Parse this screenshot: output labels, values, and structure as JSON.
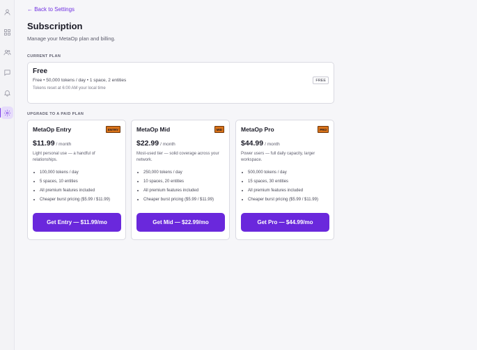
{
  "sidebar": {
    "items": [
      {
        "name": "profile",
        "icon": "user-icon"
      },
      {
        "name": "dashboard",
        "icon": "grid-icon"
      },
      {
        "name": "people",
        "icon": "users-icon"
      },
      {
        "name": "messages",
        "icon": "chat-icon"
      },
      {
        "name": "notifications",
        "icon": "bell-icon"
      },
      {
        "name": "settings",
        "icon": "gear-icon",
        "active": true
      }
    ]
  },
  "header": {
    "back_label": "← Back to Settings",
    "title": "Subscription",
    "subtitle": "Manage your MetaOp plan and billing."
  },
  "current_plan": {
    "section_label": "CURRENT PLAN",
    "name": "Free",
    "details": "Free • 50,000 tokens / day • 1 space, 2 entities",
    "reset_note": "Tokens reset at 6:00 AM your local time",
    "badge": "FREE"
  },
  "upgrade": {
    "section_label": "UPGRADE TO A PAID PLAN",
    "plans": [
      {
        "name": "MetaOp Entry",
        "badge": "ENTRY",
        "price": "$11.99",
        "period": "/ month",
        "description": "Light personal use — a handful of relationships.",
        "features": [
          "100,000 tokens / day",
          "5 spaces, 10 entities",
          "All premium features included",
          "Cheaper burst pricing ($5.99 / $11.99)"
        ],
        "cta": "Get Entry — $11.99/mo"
      },
      {
        "name": "MetaOp Mid",
        "badge": "MID",
        "price": "$22.99",
        "period": "/ month",
        "description": "Most-used tier — solid coverage across your network.",
        "features": [
          "250,000 tokens / day",
          "10 spaces, 20 entities",
          "All premium features included",
          "Cheaper burst pricing ($5.99 / $11.99)"
        ],
        "cta": "Get Mid — $22.99/mo"
      },
      {
        "name": "MetaOp Pro",
        "badge": "PRO",
        "price": "$44.99",
        "period": "/ month",
        "description": "Power users — full daily capacity, larger workspace.",
        "features": [
          "500,000 tokens / day",
          "15 spaces, 30 entities",
          "All premium features included",
          "Cheaper burst pricing ($5.99 / $11.99)"
        ],
        "cta": "Get Pro — $44.99/mo"
      }
    ]
  },
  "colors": {
    "accent": "#6a28dc",
    "badge": "#d9731a",
    "background": "#f6f6f9"
  }
}
